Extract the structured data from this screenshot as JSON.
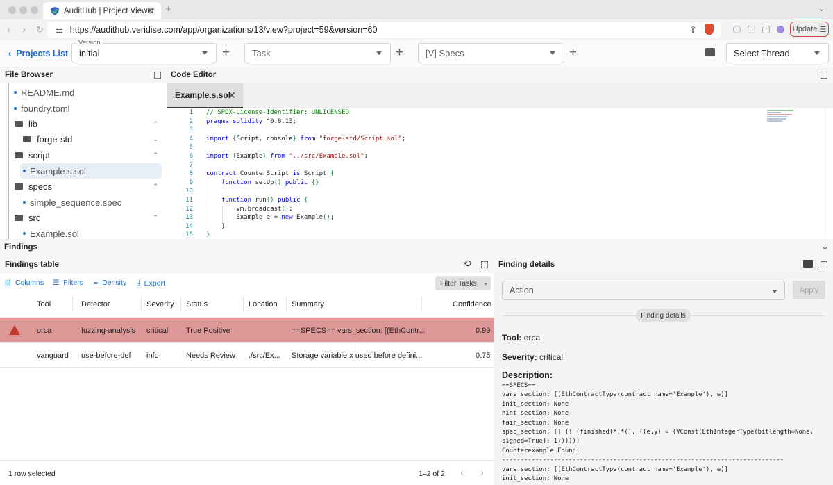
{
  "browser": {
    "tab_title": "AuditHub | Project Viewer",
    "url": "https://audithub.veridise.com/app/organizations/13/view?project=59&version=60",
    "update_label": "Update"
  },
  "toolbar": {
    "projects_link": "Projects List",
    "version_label": "Version",
    "version_value": "initial",
    "task_placeholder": "Task",
    "specs_value": "[V] Specs",
    "thread_placeholder": "Select Thread"
  },
  "file_browser": {
    "title": "File Browser",
    "items": [
      {
        "name": "README.md",
        "type": "file",
        "level": 0
      },
      {
        "name": "foundry.toml",
        "type": "file",
        "level": 0
      },
      {
        "name": "lib",
        "type": "folder",
        "level": 0,
        "expanded": true
      },
      {
        "name": "forge-std",
        "type": "folder",
        "level": 1,
        "expanded": false
      },
      {
        "name": "script",
        "type": "folder",
        "level": 0,
        "expanded": true
      },
      {
        "name": "Example.s.sol",
        "type": "file",
        "level": 1,
        "selected": true
      },
      {
        "name": "specs",
        "type": "folder",
        "level": 0,
        "expanded": true
      },
      {
        "name": "simple_sequence.spec",
        "type": "file",
        "level": 1
      },
      {
        "name": "src",
        "type": "folder",
        "level": 0,
        "expanded": true
      },
      {
        "name": "Example.sol",
        "type": "file",
        "level": 1
      }
    ]
  },
  "editor": {
    "title": "Code Editor",
    "tab": "Example.s.sol",
    "lines": [
      "// SPDX-License-Identifier: UNLICENSED",
      "pragma solidity ^0.8.13;",
      "",
      "import {Script, console} from \"forge-std/Script.sol\";",
      "",
      "import {Example} from \"../src/Example.sol\";",
      "",
      "contract CounterScript is Script {",
      "    function setUp() public {}",
      "",
      "    function run() public {",
      "        vm.broadcast();",
      "        Example e = new Example();",
      "    }",
      "}"
    ]
  },
  "findings": {
    "section_title": "Findings",
    "table_title": "Findings table",
    "toolbar": {
      "columns": "Columns",
      "filters": "Filters",
      "density": "Density",
      "export": "Export",
      "filter_tasks": "Filter Tasks"
    },
    "columns": [
      "Tool",
      "Detector",
      "Severity",
      "Status",
      "Location",
      "Summary",
      "Confidence"
    ],
    "rows": [
      {
        "tool": "orca",
        "detector": "fuzzing-analysis",
        "severity": "critical",
        "status": "True Positive",
        "location": "",
        "summary": "==SPECS== vars_section: [(EthContr...",
        "confidence": "0.99",
        "selected": true,
        "icon": "warning-icon"
      },
      {
        "tool": "vanguard",
        "detector": "use-before-def",
        "severity": "info",
        "status": "Needs Review",
        "location": "./src/Ex...",
        "summary": "Storage variable x used before defini...",
        "confidence": "0.75",
        "selected": false
      }
    ],
    "footer": {
      "selected": "1 row selected",
      "pagination": "1–2 of 2"
    }
  },
  "details": {
    "title": "Finding details",
    "action_placeholder": "Action",
    "apply_label": "Apply",
    "chip": "Finding details",
    "tool_label": "Tool:",
    "tool_value": "orca",
    "severity_label": "Severity:",
    "severity_value": "critical",
    "description_label": "Description:",
    "description": "==SPECS==\nvars_section: [(EthContractType(contract_name='Example'), e)]\ninit_section: None\nhint_section: None\nfair_section: None\nspec_section: [] (! (finished(*.*(), ((e.y) = (VConst(EthIntegerType(bitlength=None,\nsigned=True): 1))))))\nCounterexample Found:\n----------------------------------------------------------------------------\nvars_section: [(EthContractType(contract_name='Example'), e)]\ninit_section: None"
  },
  "colors": {
    "accent": "#1a6ccf",
    "selected_row": "#de9797",
    "critical": "#c0392b"
  }
}
